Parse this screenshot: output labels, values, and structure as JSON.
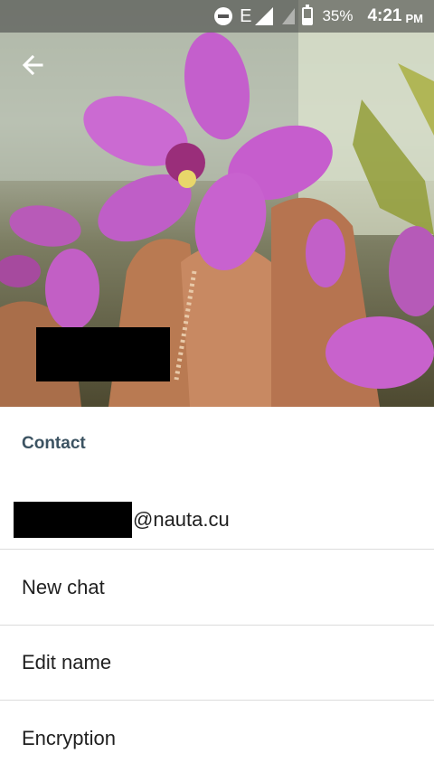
{
  "status_bar": {
    "network_type": "E",
    "battery_percent": "35%",
    "battery_level": 0.35,
    "time": "4:21",
    "ampm": "PM",
    "icons": [
      "do-not-disturb-icon",
      "signal-icon",
      "signal-secondary-icon",
      "battery-icon"
    ]
  },
  "header": {
    "back_icon": "arrow-left-icon"
  },
  "contact": {
    "section_title": "Contact",
    "email_domain": "@nauta.cu"
  },
  "menu": {
    "new_chat": "New chat",
    "edit_name": "Edit name",
    "encryption": "Encryption"
  },
  "colors": {
    "section_title": "#3c5362",
    "divider": "#dcdcdc",
    "text": "#1f1f1f"
  }
}
